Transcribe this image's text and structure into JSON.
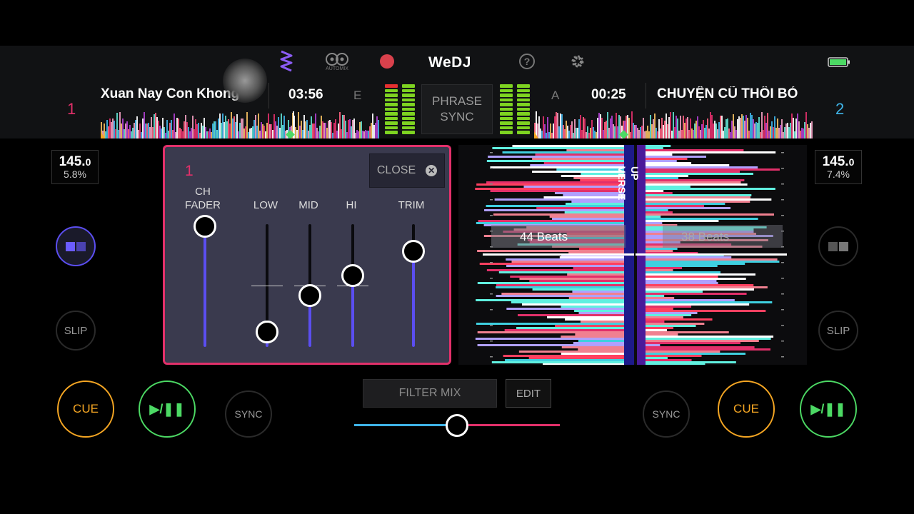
{
  "app": {
    "title": "WeDJ",
    "automix_label": "AUTOMIX"
  },
  "colors": {
    "deck1": "#e2306a",
    "deck2": "#3fb4e8",
    "fader": "#5b4ef0",
    "cue": "#f5a623",
    "play": "#4cd964",
    "vu": "#7ed321"
  },
  "top_icons": [
    "waveform-icon",
    "automix-icon",
    "record-icon",
    "help-icon",
    "gear-icon",
    "battery-icon"
  ],
  "deck1": {
    "number": "1",
    "title": "Xuan Nay Con Khong",
    "time": "03:56",
    "key": "E",
    "bpm": "145.",
    "bpm_decimal": "0",
    "pitch": "5.8%",
    "progress": 0.69
  },
  "deck2": {
    "number": "2",
    "title": "CHUYỆN CŨ THÔI BỎ",
    "time": "00:25",
    "key": "A",
    "bpm": "145.",
    "bpm_decimal": "0",
    "pitch": "7.4%",
    "progress": 0.0
  },
  "phrase_sync": {
    "line1": "PHRASE",
    "line2": "SYNC"
  },
  "mixer": {
    "channel": "1",
    "close_label": "CLOSE",
    "labels": {
      "ch_fader_1": "CH",
      "ch_fader_2": "FADER",
      "low": "LOW",
      "mid": "MID",
      "hi": "HI",
      "trim": "TRIM"
    },
    "values": {
      "ch_fader": 0.98,
      "low": 0.12,
      "mid": 0.42,
      "hi": 0.58,
      "trim": 0.78
    }
  },
  "waveform": {
    "left_beats": "44 Beats",
    "right_beats": "38 Beats",
    "phrase_marker_1": "UP",
    "phrase_marker_2": "VERSE"
  },
  "buttons": {
    "slip": "SLIP",
    "cue": "CUE",
    "play_pause": "▶/❚❚",
    "sync": "SYNC",
    "filter_mix": "FILTER MIX",
    "edit": "EDIT"
  },
  "crossfader": {
    "position": 0.5
  }
}
